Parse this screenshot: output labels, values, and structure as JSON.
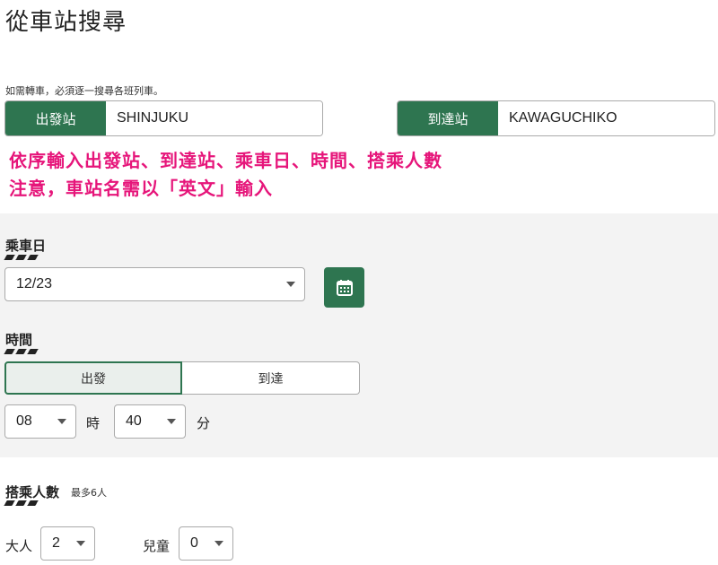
{
  "page": {
    "title": "從車站搜尋",
    "note": "如需轉車，必須逐一搜尋各班列車。"
  },
  "stations": {
    "from_label": "出發站",
    "from_value": "SHINJUKU",
    "to_label": "到達站",
    "to_value": "KAWAGUCHIKO"
  },
  "annotation": {
    "line1": "依序輸入出發站、到達站、乘車日、時間、搭乘人數",
    "line2": "注意，車站名需以「英文」輸入"
  },
  "date": {
    "section_title": "乘車日",
    "selected": "12/23",
    "calendar_icon": "calendar-icon"
  },
  "time": {
    "section_title": "時間",
    "depart_label": "出發",
    "arrive_label": "到達",
    "hour_value": "08",
    "hour_unit": "時",
    "minute_value": "40",
    "minute_unit": "分"
  },
  "passengers": {
    "section_title": "搭乘人數",
    "max_note": "最多6人",
    "adult_label": "大人",
    "adult_value": "2",
    "child_label": "兒童",
    "child_value": "0"
  },
  "colors": {
    "accent": "#2e7550",
    "annotation": "#e6157a",
    "panel_bg": "#f3f3f3"
  }
}
